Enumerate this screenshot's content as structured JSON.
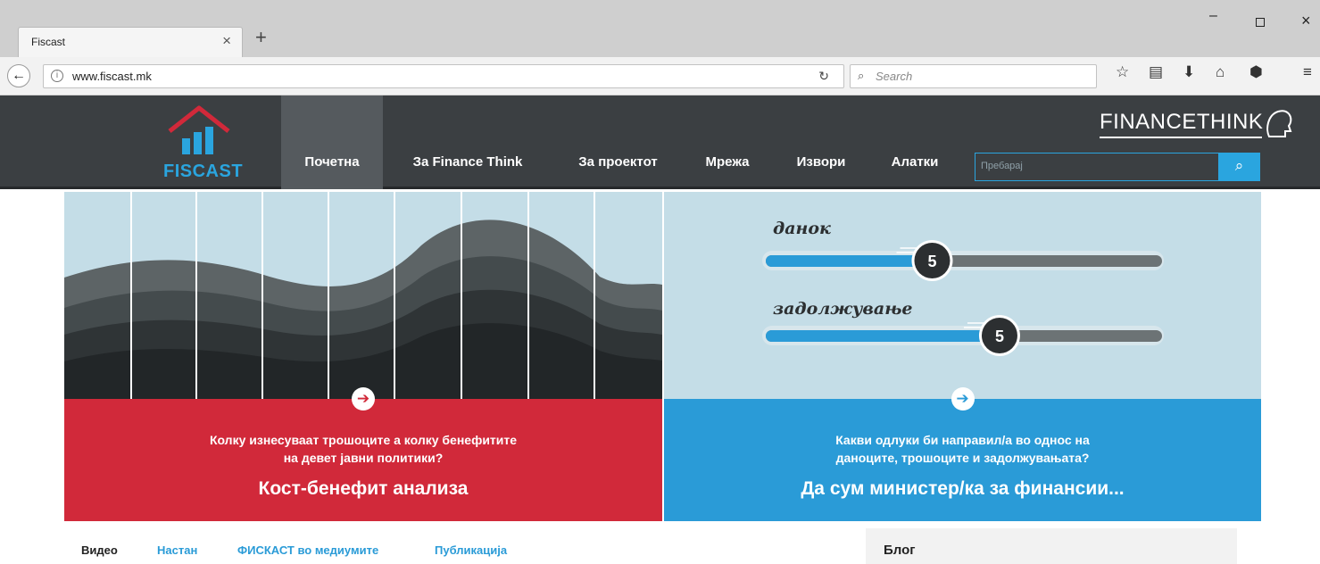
{
  "browser": {
    "tab_title": "Fiscast",
    "tab_close": "×",
    "new_tab": "+",
    "url": "www.fiscast.mk",
    "search_placeholder": "Search",
    "window_min": "–",
    "window_close": "×",
    "icons": [
      "back-arrow-icon",
      "info-icon",
      "reload-icon",
      "search-icon",
      "star-icon",
      "clipboard-icon",
      "download-icon",
      "home-icon",
      "pocket-icon",
      "menu-icon"
    ]
  },
  "site": {
    "logo_text": "FISCAST",
    "nav": [
      "Почетна",
      "За Finance Think",
      "За проектот",
      "Мрежа",
      "Извори",
      "Алатки"
    ],
    "active_nav": "Почетна",
    "search_placeholder": "Пребарај",
    "partner_logo": "FINANCETHINK",
    "partner_logo_tag": "THINK"
  },
  "hero": {
    "left": {
      "question_line1": "Колку изнесуваат трошоците а колку бенефитите",
      "question_line2": "на девет јавни политики?",
      "title": "Кост-бенефит анализа"
    },
    "right": {
      "slider1_label": "данок",
      "slider1_value": "5",
      "slider1_level": 0.42,
      "slider2_label": "задолжување",
      "slider2_value": "5",
      "slider2_level": 0.59,
      "question_line1": "Какви одлуки би направил/а во однос на",
      "question_line2": "даноците, трошоците и задолжувањата?",
      "title": "Да сум министер/ка за финансии..."
    }
  },
  "bottom": {
    "tabs": [
      "Видео",
      "Настан",
      "ФИСКАСТ во медиумите",
      "Публикација"
    ],
    "active_tab": "Видео",
    "blog_title": "Блог"
  },
  "colors": {
    "accent_blue": "#2aa5df",
    "header_dark": "#3b3f42",
    "hero_red": "#d1293a",
    "hero_blue": "#2a9bd7",
    "hero_light_blue": "#c4dde7"
  }
}
